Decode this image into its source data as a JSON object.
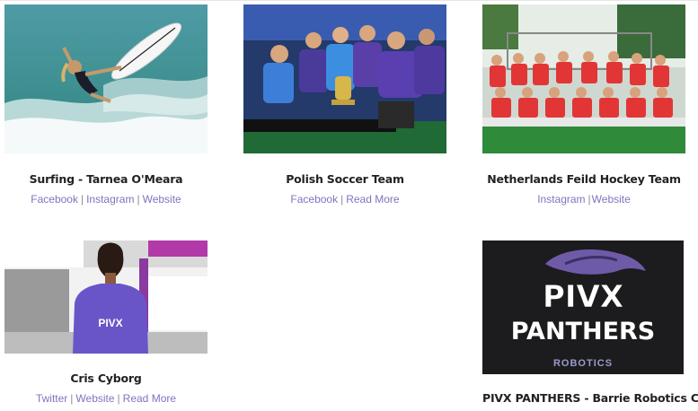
{
  "cards": [
    {
      "title": "Surfing - Tarnea O'Meara",
      "image_desc_icon": "surfer-photo",
      "links": [
        "Facebook",
        "Instagram",
        "Website"
      ]
    },
    {
      "title": "Polish Soccer Team",
      "image_desc_icon": "soccer-team-photo",
      "links": [
        "Facebook",
        "Read More"
      ]
    },
    {
      "title": "Netherlands Feild Hockey Team",
      "image_desc_icon": "hockey-team-photo",
      "links": [
        "Instagram",
        "Website"
      ]
    },
    {
      "title": "Cris Cyborg",
      "image_desc_icon": "fighter-photo",
      "links": [
        "Twitter",
        "Website",
        "Read More"
      ]
    },
    {
      "title": "PIVX PANTHERS - Barrie Robotics Club",
      "image_desc_icon": "panthers-logo",
      "logo": {
        "line1": "PIVX",
        "line2": "PANTHERS",
        "line3": "ROBOTICS"
      },
      "links": []
    }
  ],
  "colors": {
    "link": "#7f74c0",
    "title": "#222222"
  }
}
